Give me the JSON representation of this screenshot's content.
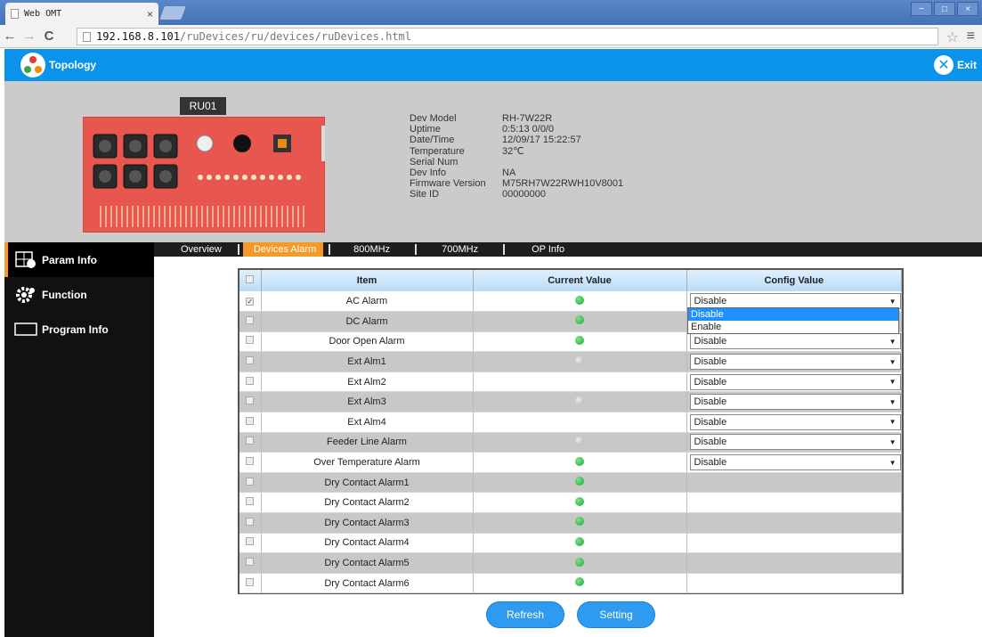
{
  "browser": {
    "tab_title": "Web OMT",
    "tab_close": "×",
    "url_host": "192.168.8.101",
    "url_path": "/ruDevices/ru/devices/ruDevices.html",
    "back": "←",
    "forward": "→",
    "reload": "C",
    "star": "☆",
    "menu": "≡",
    "win_min": "−",
    "win_max": "□",
    "win_close": "×"
  },
  "header": {
    "topology_label": "Topology",
    "exit_label": "Exit",
    "exit_glyph": "✕"
  },
  "device": {
    "ru_label": "RU01",
    "info": [
      {
        "key": "Dev Model",
        "value": "RH-7W22R"
      },
      {
        "key": "Uptime",
        "value": "0:5:13 0/0/0"
      },
      {
        "key": "Date/Time",
        "value": "12/09/17 15:22:57"
      },
      {
        "key": "Temperature",
        "value": "32℃"
      },
      {
        "key": "Serial Num",
        "value": ""
      },
      {
        "key": "Dev Info",
        "value": "NA"
      },
      {
        "key": "Firmware Version",
        "value": "M75RH7W22RWH10V8001"
      },
      {
        "key": "Site ID",
        "value": "00000000"
      }
    ]
  },
  "subtabs": [
    "Overview",
    "Devices Alarm",
    "800MHz",
    "700MHz",
    "OP Info"
  ],
  "sidebar": [
    {
      "label": "Param Info",
      "icon": "param-info-icon"
    },
    {
      "label": "Function",
      "icon": "gear-icon"
    },
    {
      "label": "Program Info",
      "icon": "monitor-icon"
    }
  ],
  "table": {
    "headers": [
      "Item",
      "Current Value",
      "Config Value"
    ],
    "rows": [
      {
        "item": "AC Alarm",
        "status": "green",
        "checked": true,
        "config": "Disable"
      },
      {
        "item": "DC Alarm",
        "status": "green",
        "checked": false,
        "config": ""
      },
      {
        "item": "Door Open Alarm",
        "status": "green",
        "checked": false,
        "config": "Disable"
      },
      {
        "item": "Ext Alm1",
        "status": "grey",
        "checked": false,
        "config": "Disable"
      },
      {
        "item": "Ext Alm2",
        "status": "blank",
        "checked": false,
        "config": "Disable"
      },
      {
        "item": "Ext Alm3",
        "status": "grey",
        "checked": false,
        "config": "Disable"
      },
      {
        "item": "Ext Alm4",
        "status": "blank",
        "checked": false,
        "config": "Disable"
      },
      {
        "item": "Feeder Line Alarm",
        "status": "grey",
        "checked": false,
        "config": "Disable"
      },
      {
        "item": "Over Temperature Alarm",
        "status": "green",
        "checked": false,
        "config": "Disable"
      },
      {
        "item": "Dry Contact Alarm1",
        "status": "green",
        "checked": false,
        "config": ""
      },
      {
        "item": "Dry Contact Alarm2",
        "status": "green",
        "checked": false,
        "config": ""
      },
      {
        "item": "Dry Contact Alarm3",
        "status": "green",
        "checked": false,
        "config": ""
      },
      {
        "item": "Dry Contact Alarm4",
        "status": "green",
        "checked": false,
        "config": ""
      },
      {
        "item": "Dry Contact Alarm5",
        "status": "green",
        "checked": false,
        "config": ""
      },
      {
        "item": "Dry Contact Alarm6",
        "status": "green",
        "checked": false,
        "config": ""
      }
    ]
  },
  "dropdown": {
    "options": [
      "Disable",
      "Enable"
    ],
    "highlighted": "Disable"
  },
  "buttons": {
    "refresh": "Refresh",
    "setting": "Setting"
  },
  "colors": {
    "accent": "#0a93ea",
    "active_tab": "#f59a2a",
    "status_green": "#1ea53a"
  }
}
